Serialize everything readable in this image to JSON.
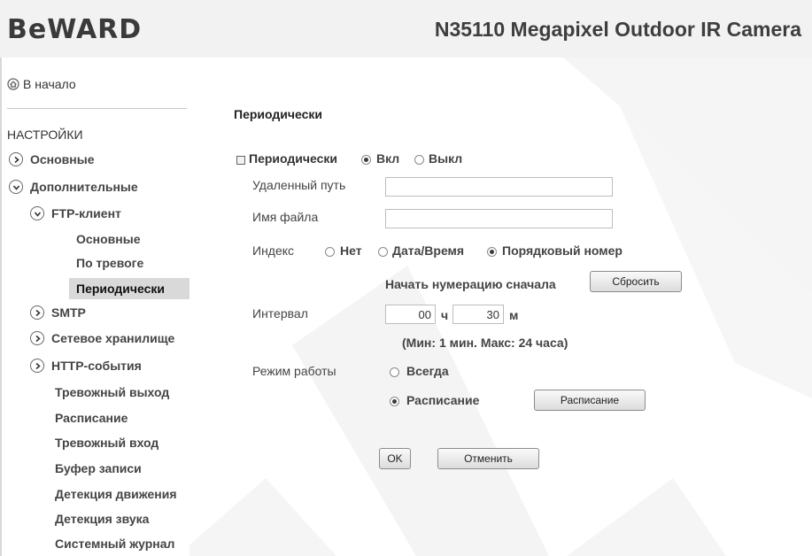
{
  "header": {
    "logo": "BeWARD",
    "model": "N35110 Megapixel Outdoor IR Camera"
  },
  "sidebar": {
    "home_label": "В начало",
    "settings_title": "НАСТРОЙКИ",
    "items": [
      {
        "label": "Основные",
        "arrow": "right"
      },
      {
        "label": "Дополнительные",
        "arrow": "down"
      },
      {
        "label": "FTP-клиент",
        "arrow": "down"
      },
      {
        "label": "Основные"
      },
      {
        "label": "По тревоге"
      },
      {
        "label": "Периодически",
        "active": true
      },
      {
        "label": "SMTP",
        "arrow": "right"
      },
      {
        "label": "Сетевое хранилище",
        "arrow": "right"
      },
      {
        "label": "HTTP-события",
        "arrow": "right"
      },
      {
        "label": "Тревожный выход"
      },
      {
        "label": "Расписание"
      },
      {
        "label": "Тревожный вход"
      },
      {
        "label": "Буфер записи"
      },
      {
        "label": "Детекция движения"
      },
      {
        "label": "Детекция звука"
      },
      {
        "label": "Системный журнал"
      }
    ]
  },
  "main": {
    "section_title": "Периодически",
    "periodic": {
      "label": "Периодически",
      "on": "Вкл",
      "off": "Выкл",
      "selected": "on"
    },
    "remote_path": {
      "label": "Удаленный путь",
      "value": ""
    },
    "file_name": {
      "label": "Имя файла",
      "value": ""
    },
    "index": {
      "label": "Индекс",
      "none": "Нет",
      "datetime": "Дата/Время",
      "seq": "Порядковый номер",
      "selected": "seq",
      "restart_label": "Начать нумерацию сначала",
      "reset_button": "Сбросить"
    },
    "interval": {
      "label": "Интервал",
      "hours": "00",
      "hours_unit": "ч",
      "minutes": "30",
      "minutes_unit": "м",
      "hint": "(Мин: 1 мин. Макс: 24 часа)"
    },
    "mode": {
      "label": "Режим работы",
      "always": "Всегда",
      "schedule": "Расписание",
      "selected": "schedule",
      "schedule_button": "Расписание"
    },
    "ok_button": "OK",
    "cancel_button": "Отменить"
  },
  "colors": {
    "header_bg": "#f2f2f2",
    "active_item_bg": "#d9d9d9",
    "watermark": "#f3f3f3"
  }
}
